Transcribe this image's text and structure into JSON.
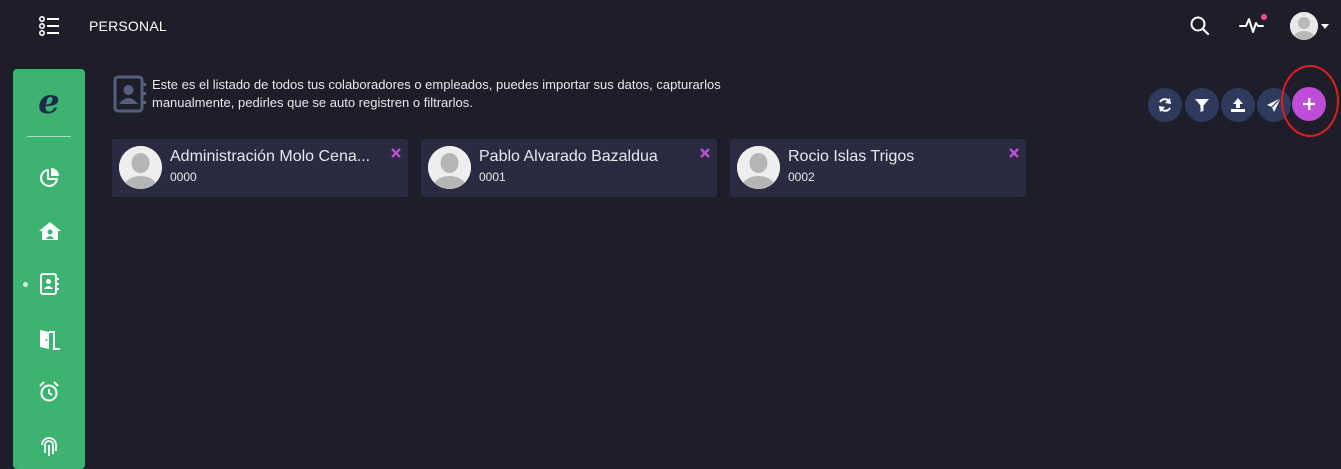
{
  "header": {
    "title": "PERSONAL",
    "menu_icon": "menu-list-icon",
    "search_icon": "search-icon",
    "activity_icon": "activity-icon",
    "avatar_icon": "user-avatar-icon"
  },
  "sidebar": {
    "brand_letter": "e",
    "items": [
      {
        "icon": "chart-pie-icon",
        "active": false
      },
      {
        "icon": "home-user-icon",
        "active": false
      },
      {
        "icon": "contacts-book-icon",
        "active": true
      },
      {
        "icon": "door-exit-icon",
        "active": false
      },
      {
        "icon": "alarm-clock-icon",
        "active": false
      },
      {
        "icon": "fingerprint-icon",
        "active": false
      }
    ]
  },
  "info": {
    "line1": "Este es el listado de todos tus colaboradores o empleados, puedes importar sus datos, capturarlos",
    "line2": "manualmente, pedirles que se auto registren o filtrarlos."
  },
  "actions": [
    {
      "icon": "refresh-icon"
    },
    {
      "icon": "filter-icon"
    },
    {
      "icon": "upload-icon"
    },
    {
      "icon": "send-icon"
    },
    {
      "icon": "plus-icon"
    }
  ],
  "employees": [
    {
      "name": "Administración Molo Cena...",
      "code": "0000"
    },
    {
      "name": "Pablo Alvarado Bazaldua",
      "code": "0001"
    },
    {
      "name": "Rocio Islas Trigos",
      "code": "0002"
    }
  ],
  "colors": {
    "background": "#1e1e2a",
    "sidebar": "#3cb371",
    "card": "#2a2b40",
    "action_button": "#2f3b5e",
    "add_button": "#c04dd8",
    "remove_x": "#c04dd8",
    "highlight_ring": "#e11d1d"
  }
}
